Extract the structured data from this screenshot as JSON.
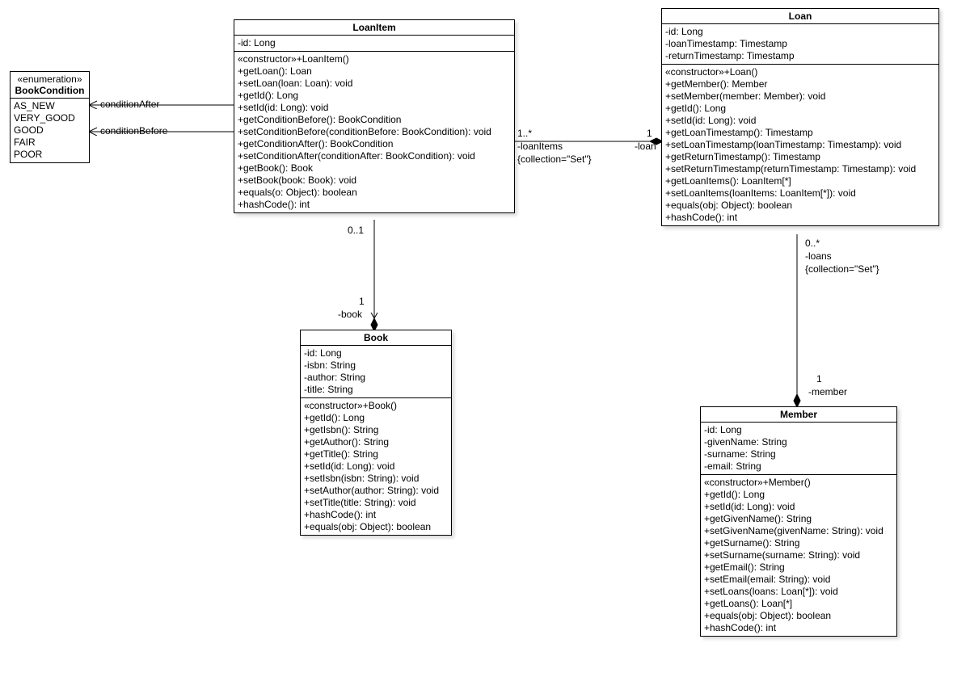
{
  "enum": {
    "stereotype": "«enumeration»",
    "name": "BookCondition",
    "literals": [
      "AS_NEW",
      "VERY_GOOD",
      "GOOD",
      "FAIR",
      "POOR"
    ]
  },
  "loanItem": {
    "name": "LoanItem",
    "attrs": [
      "-id: Long"
    ],
    "ops": [
      "«constructor»+LoanItem()",
      "+getLoan(): Loan",
      "+setLoan(loan: Loan): void",
      "+getId(): Long",
      "+setId(id: Long): void",
      "+getConditionBefore(): BookCondition",
      "+setConditionBefore(conditionBefore: BookCondition): void",
      "+getConditionAfter(): BookCondition",
      "+setConditionAfter(conditionAfter: BookCondition): void",
      "+getBook(): Book",
      "+setBook(book: Book): void",
      "+equals(o: Object): boolean",
      "+hashCode(): int"
    ]
  },
  "loan": {
    "name": "Loan",
    "attrs": [
      "-id: Long",
      "-loanTimestamp: Timestamp",
      "-returnTimestamp: Timestamp"
    ],
    "ops": [
      "«constructor»+Loan()",
      "+getMember(): Member",
      "+setMember(member: Member): void",
      "+getId(): Long",
      "+setId(id: Long): void",
      "+getLoanTimestamp(): Timestamp",
      "+setLoanTimestamp(loanTimestamp: Timestamp): void",
      "+getReturnTimestamp(): Timestamp",
      "+setReturnTimestamp(returnTimestamp: Timestamp): void",
      "+getLoanItems(): LoanItem[*]",
      "+setLoanItems(loanItems: LoanItem[*]): void",
      "+equals(obj: Object): boolean",
      "+hashCode(): int"
    ]
  },
  "book": {
    "name": "Book",
    "attrs": [
      "-id: Long",
      "-isbn: String",
      "-author: String",
      "-title: String"
    ],
    "ops": [
      "«constructor»+Book()",
      "+getId(): Long",
      "+getIsbn(): String",
      "+getAuthor(): String",
      "+getTitle(): String",
      "+setId(id: Long): void",
      "+setIsbn(isbn: String): void",
      "+setAuthor(author: String): void",
      "+setTitle(title: String): void",
      "+hashCode(): int",
      "+equals(obj: Object): boolean"
    ]
  },
  "member": {
    "name": "Member",
    "attrs": [
      "-id: Long",
      "-givenName: String",
      "-surname: String",
      "-email: String"
    ],
    "ops": [
      "«constructor»+Member()",
      "+getId(): Long",
      "+setId(id: Long): void",
      "+getGivenName(): String",
      "+setGivenName(givenName: String): void",
      "+getSurname(): String",
      "+setSurname(surname: String): void",
      "+getEmail(): String",
      "+setEmail(email: String): void",
      "+setLoans(loans: Loan[*]): void",
      "+getLoans(): Loan[*]",
      "+equals(obj: Object): boolean",
      "+hashCode(): int"
    ]
  },
  "assocLabels": {
    "conditionAfter": "-conditionAfter",
    "conditionBefore": "-conditionBefore",
    "loanItems_mult": "1..*",
    "loanItems_role": "-loanItems",
    "loanItems_coll": "{collection=\"Set\"}",
    "loan_mult": "1",
    "loan_role": "-loan",
    "li_book_top": "0..1",
    "li_book_mult": "1",
    "li_book_role": "-book",
    "loans_mult": "0..*",
    "loans_role": "-loans",
    "loans_coll": "{collection=\"Set\"}",
    "member_mult": "1",
    "member_role": "-member"
  }
}
